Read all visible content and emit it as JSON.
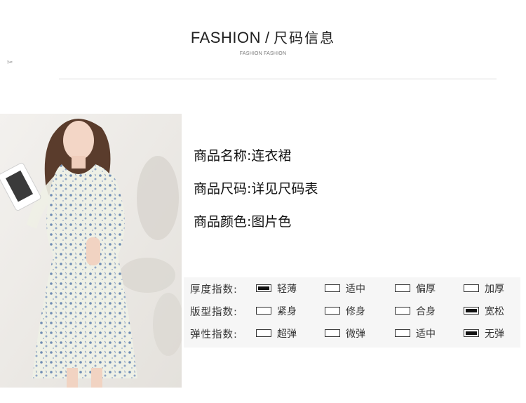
{
  "header": {
    "title_en": "FASHION",
    "slash": "/",
    "title_cn": "尺码信息",
    "subtitle": "FASHION FASHION",
    "scissor": "✂"
  },
  "product": {
    "name": "商品名称:连衣裙",
    "size": "商品尺码:详见尺码表",
    "color": "商品颜色:图片色"
  },
  "attributes": [
    {
      "label": "厚度指数:",
      "options": [
        {
          "text": "轻薄",
          "selected": true
        },
        {
          "text": "适中",
          "selected": false
        },
        {
          "text": "偏厚",
          "selected": false
        },
        {
          "text": "加厚",
          "selected": false
        }
      ]
    },
    {
      "label": "版型指数:",
      "options": [
        {
          "text": "紧身",
          "selected": false
        },
        {
          "text": "修身",
          "selected": false
        },
        {
          "text": "合身",
          "selected": false
        },
        {
          "text": "宽松",
          "selected": true
        }
      ]
    },
    {
      "label": "弹性指数:",
      "options": [
        {
          "text": "超弹",
          "selected": false
        },
        {
          "text": "微弹",
          "selected": false
        },
        {
          "text": "适中",
          "selected": false
        },
        {
          "text": "无弹",
          "selected": true
        }
      ]
    }
  ],
  "colors": {
    "selected_fill": "#111111",
    "table_bg": "#f6f6f6",
    "divider": "#d9d9d9",
    "dress_base": "#eef0e6",
    "dress_print": "#6f8cb3"
  }
}
